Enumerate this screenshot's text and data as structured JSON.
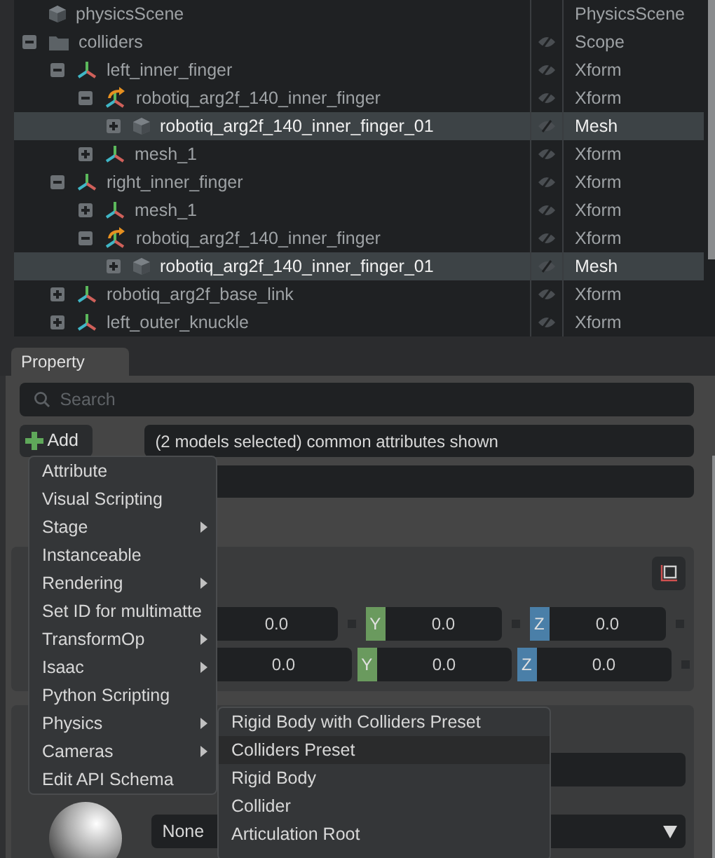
{
  "stage": {
    "tree": [
      {
        "name": "physicsScene",
        "kind": "cube",
        "type": "PhysicsScene",
        "selected": false,
        "visibility_toggle": false
      },
      {
        "name": "colliders",
        "kind": "folder",
        "type": "Scope",
        "selected": false,
        "visibility_toggle": true,
        "expanded": true,
        "children": [
          {
            "name": "left_inner_finger",
            "kind": "xform",
            "type": "Xform",
            "selected": false,
            "visibility_toggle": true,
            "expanded": true,
            "children": [
              {
                "name": "robotiq_arg2f_140_inner_finger",
                "kind": "reference",
                "type": "Xform",
                "selected": false,
                "visibility_toggle": true,
                "expanded": true,
                "children": [
                  {
                    "name": "robotiq_arg2f_140_inner_finger_01",
                    "kind": "cube",
                    "type": "Mesh",
                    "selected": true,
                    "visibility_toggle": true,
                    "expanded": false
                  }
                ]
              },
              {
                "name": "mesh_1",
                "kind": "xform",
                "type": "Xform",
                "selected": false,
                "visibility_toggle": true,
                "expanded": false
              }
            ]
          },
          {
            "name": "right_inner_finger",
            "kind": "xform",
            "type": "Xform",
            "selected": false,
            "visibility_toggle": true,
            "expanded": true,
            "children": [
              {
                "name": "mesh_1",
                "kind": "xform",
                "type": "Xform",
                "selected": false,
                "visibility_toggle": true,
                "expanded": false
              },
              {
                "name": "robotiq_arg2f_140_inner_finger",
                "kind": "reference",
                "type": "Xform",
                "selected": false,
                "visibility_toggle": true,
                "expanded": true,
                "children": [
                  {
                    "name": "robotiq_arg2f_140_inner_finger_01",
                    "kind": "cube",
                    "type": "Mesh",
                    "selected": true,
                    "visibility_toggle": true,
                    "expanded": false
                  }
                ]
              }
            ]
          },
          {
            "name": "robotiq_arg2f_base_link",
            "kind": "xform",
            "type": "Xform",
            "selected": false,
            "visibility_toggle": true,
            "expanded": false
          },
          {
            "name": "left_outer_knuckle",
            "kind": "xform",
            "type": "Xform",
            "selected": false,
            "visibility_toggle": true,
            "expanded": false
          }
        ]
      }
    ]
  },
  "property": {
    "tab": "Property",
    "search": {
      "placeholder": "Search"
    },
    "add_button": "Add",
    "info_field": "(2 models selected) common attributes shown",
    "transform_rows": [
      [
        {
          "kind": "x",
          "value": "0.0"
        },
        {
          "kind": "y",
          "label": "Y",
          "value": "0.0"
        },
        {
          "kind": "z",
          "label": "Z",
          "value": "0.0"
        }
      ],
      [
        {
          "kind": "x",
          "value": "0.0"
        },
        {
          "kind": "y",
          "label": "Y",
          "value": "0.0"
        },
        {
          "kind": "z",
          "label": "Z",
          "value": "0.0"
        }
      ]
    ],
    "material_dropdown": "None"
  },
  "add_menu": [
    {
      "label": "Attribute",
      "submenu": false
    },
    {
      "label": "Visual Scripting",
      "submenu": false
    },
    {
      "label": "Stage",
      "submenu": true
    },
    {
      "label": "Instanceable",
      "submenu": false
    },
    {
      "label": "Rendering",
      "submenu": true
    },
    {
      "label": "Set ID for multimatte",
      "submenu": false
    },
    {
      "label": "TransformOp",
      "submenu": true
    },
    {
      "label": "Isaac",
      "submenu": true
    },
    {
      "label": "Python Scripting",
      "submenu": false
    },
    {
      "label": "Physics",
      "submenu": true
    },
    {
      "label": "Cameras",
      "submenu": true
    },
    {
      "label": "Edit API Schema",
      "submenu": false
    }
  ],
  "physics_submenu": [
    {
      "label": "Rigid Body with Colliders Preset",
      "selected": false
    },
    {
      "label": "Colliders Preset",
      "selected": true
    },
    {
      "label": "Rigid Body",
      "selected": false
    },
    {
      "label": "Collider",
      "selected": false
    },
    {
      "label": "Articulation Root",
      "selected": false
    }
  ]
}
